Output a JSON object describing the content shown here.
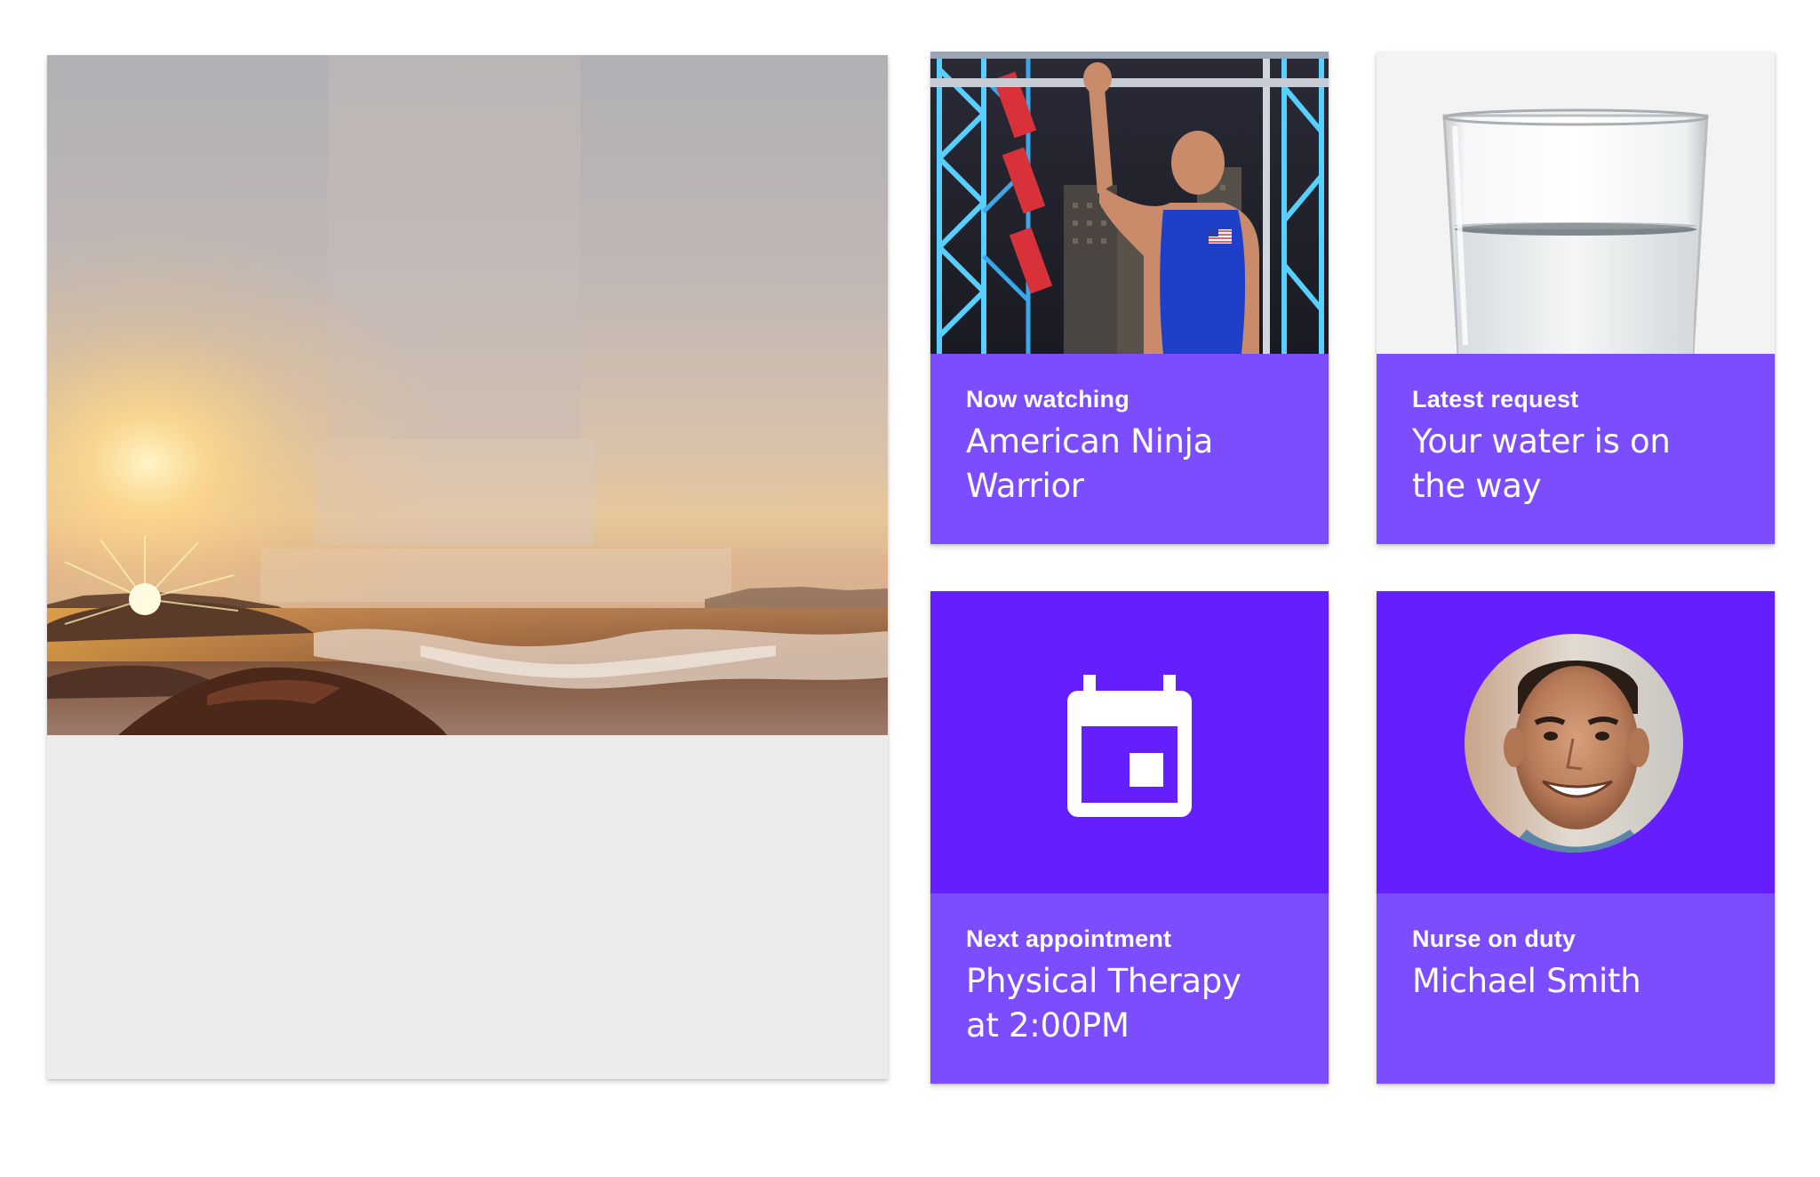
{
  "hero": {
    "image": "sunset-ocean-waves-photo"
  },
  "tiles": {
    "tv": {
      "eyebrow": "Now watching",
      "headline": "American Ninja\nWarrior",
      "image": "ninja-warrior-photo"
    },
    "request": {
      "eyebrow": "Latest request",
      "headline": "Your water is on\nthe way",
      "image": "water-glass-photo"
    },
    "appointment": {
      "eyebrow": "Next appointment",
      "headline": "Physical Therapy\nat 2:00PM",
      "icon": "calendar-icon"
    },
    "nurse": {
      "eyebrow": "Nurse on duty",
      "headline": "Michael Smith",
      "image": "nurse-avatar-photo"
    }
  },
  "colors": {
    "caption_bg": "#7c4dff",
    "accent_bg": "#651fff",
    "hero_body_bg": "#ececec",
    "page_bg": "#ffffff"
  }
}
